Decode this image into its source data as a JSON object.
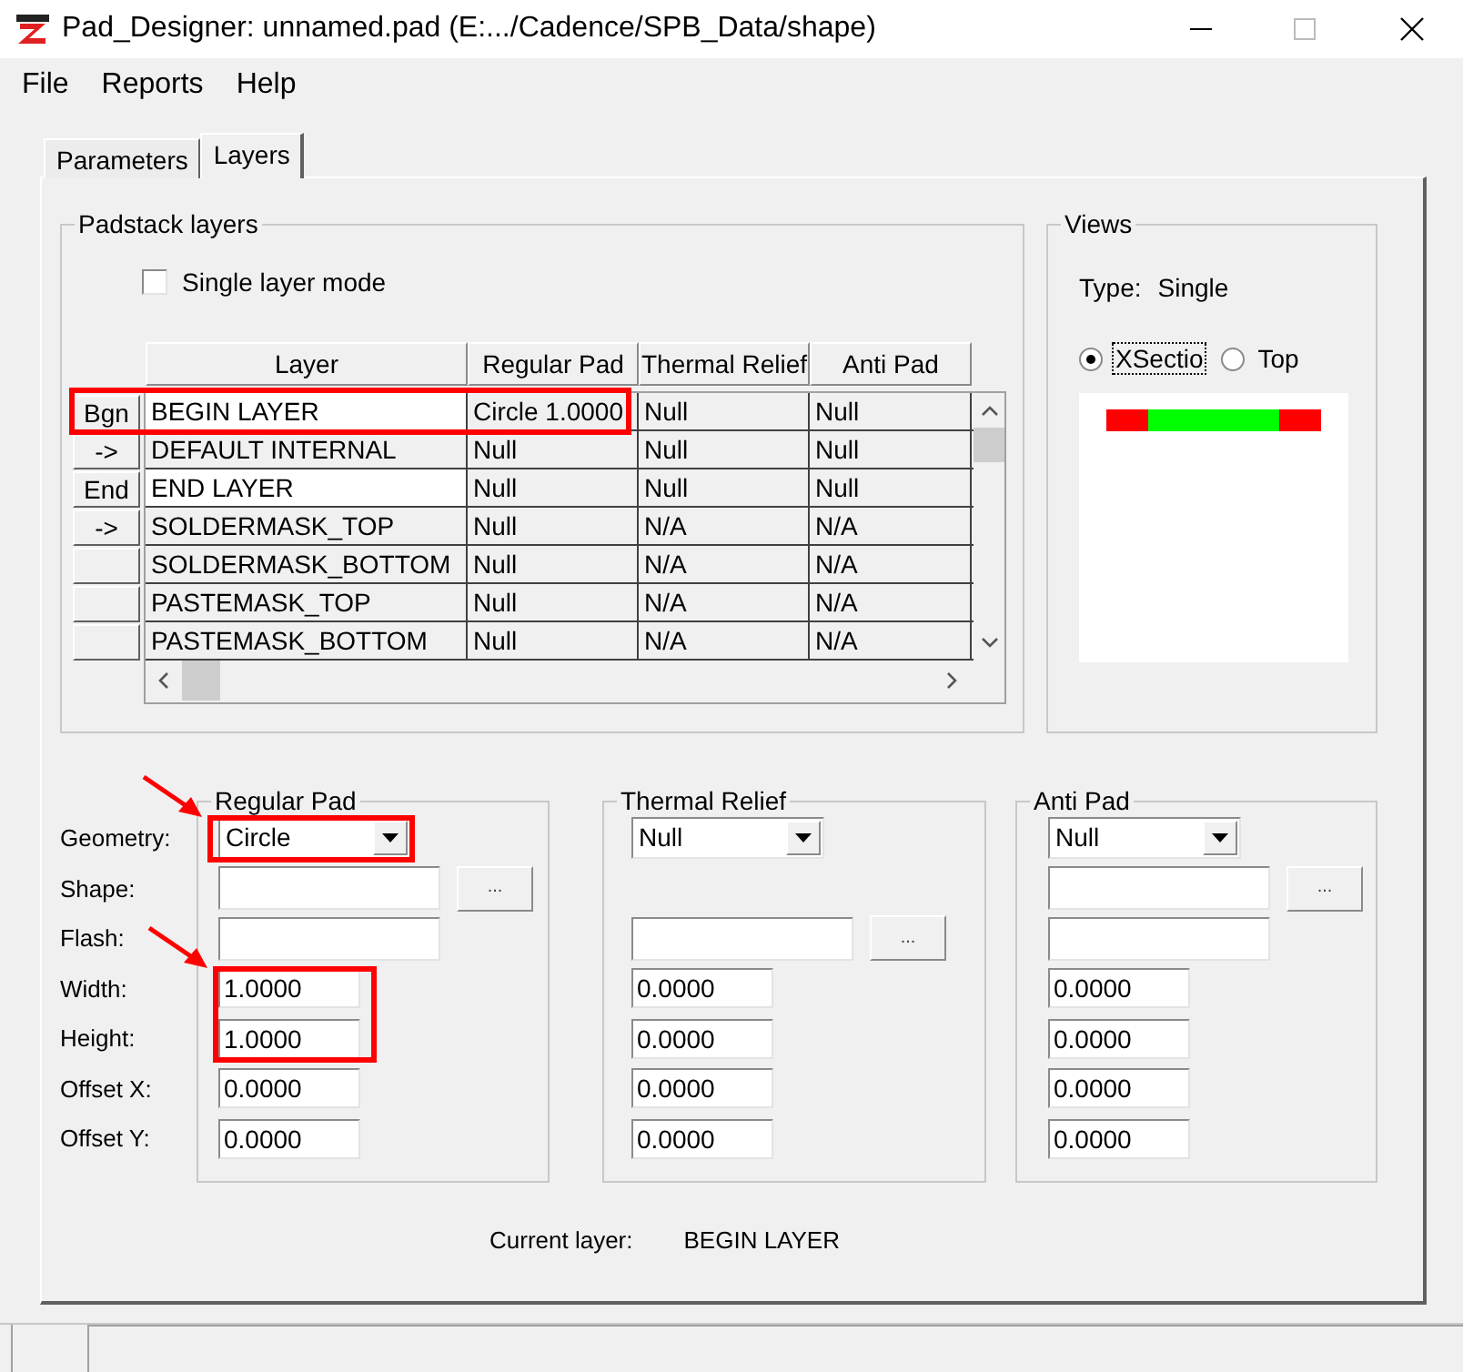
{
  "window": {
    "title": "Pad_Designer: unnamed.pad (E:.../Cadence/SPB_Data/shape)"
  },
  "menu": [
    "File",
    "Reports",
    "Help"
  ],
  "tabs": [
    {
      "label": "Parameters",
      "selected": false
    },
    {
      "label": "Layers",
      "selected": true
    }
  ],
  "padstack_layers": {
    "title": "Padstack layers",
    "single_layer_mode": {
      "label": "Single layer mode",
      "checked": false
    },
    "columns": [
      "Layer",
      "Regular Pad",
      "Thermal Relief",
      "Anti Pad"
    ],
    "rows": [
      {
        "button": "Bgn",
        "layer": "BEGIN LAYER",
        "regular_pad": "Circle 1.0000",
        "thermal_relief": "Null",
        "anti_pad": "Null",
        "emphasized": true,
        "marked": true
      },
      {
        "button": "->",
        "layer": "DEFAULT INTERNAL",
        "regular_pad": "Null",
        "thermal_relief": "Null",
        "anti_pad": "Null",
        "emphasized": false,
        "marked": false
      },
      {
        "button": "End",
        "layer": "END LAYER",
        "regular_pad": "Null",
        "thermal_relief": "Null",
        "anti_pad": "Null",
        "emphasized": true,
        "marked": false
      },
      {
        "button": "->",
        "layer": "SOLDERMASK_TOP",
        "regular_pad": "Null",
        "thermal_relief": "N/A",
        "anti_pad": "N/A",
        "emphasized": false,
        "marked": false
      },
      {
        "layer": "SOLDERMASK_BOTTOM",
        "regular_pad": "Null",
        "thermal_relief": "N/A",
        "anti_pad": "N/A",
        "emphasized": false,
        "marked": false
      },
      {
        "layer": "PASTEMASK_TOP",
        "regular_pad": "Null",
        "thermal_relief": "N/A",
        "anti_pad": "N/A",
        "emphasized": false,
        "marked": false
      },
      {
        "layer": "PASTEMASK_BOTTOM",
        "regular_pad": "Null",
        "thermal_relief": "N/A",
        "anti_pad": "N/A",
        "emphasized": false,
        "marked": false
      }
    ]
  },
  "views": {
    "title": "Views",
    "type_label": "Type:",
    "type_value": "Single",
    "options": [
      {
        "label": "XSectio",
        "selected": true,
        "focused": true
      },
      {
        "label": "Top",
        "selected": false,
        "focused": false
      }
    ],
    "preview_segments": [
      {
        "color": "#ff0000"
      },
      {
        "color": "#00ff00"
      },
      {
        "color": "#ff0000"
      }
    ]
  },
  "field_labels": [
    "Geometry:",
    "Shape:",
    "Flash:",
    "Width:",
    "Height:",
    "Offset X:",
    "Offset Y:"
  ],
  "pads": [
    {
      "title": "Regular Pad",
      "rows": [
        {
          "kind": "dropdown",
          "value": "Circle",
          "marked": true
        },
        {
          "kind": "browse",
          "button": "...",
          "marked": false
        },
        {
          "kind": "text",
          "marked": false
        },
        {
          "kind": "number",
          "value": "1.0000",
          "marked": true
        },
        {
          "kind": "number",
          "value": "1.0000",
          "marked": true
        },
        {
          "kind": "number",
          "value": "0.0000",
          "marked": false
        },
        {
          "kind": "number",
          "value": "0.0000",
          "marked": false
        }
      ]
    },
    {
      "title": "Thermal Relief",
      "rows": [
        {
          "kind": "dropdown",
          "value": "Null",
          "marked": false
        },
        {
          "kind": "empty",
          "marked": false
        },
        {
          "kind": "browse",
          "button": "...",
          "marked": false
        },
        {
          "kind": "number",
          "value": "0.0000",
          "marked": false
        },
        {
          "kind": "number",
          "value": "0.0000",
          "marked": false
        },
        {
          "kind": "number",
          "value": "0.0000",
          "marked": false
        },
        {
          "kind": "number",
          "value": "0.0000",
          "marked": false
        }
      ]
    },
    {
      "title": "Anti Pad",
      "rows": [
        {
          "kind": "dropdown",
          "value": "Null",
          "marked": false
        },
        {
          "kind": "browse",
          "button": "...",
          "marked": false
        },
        {
          "kind": "text",
          "marked": false
        },
        {
          "kind": "number",
          "value": "0.0000",
          "marked": false
        },
        {
          "kind": "number",
          "value": "0.0000",
          "marked": false
        },
        {
          "kind": "number",
          "value": "0.0000",
          "marked": false
        },
        {
          "kind": "number",
          "value": "0.0000",
          "marked": false
        }
      ]
    }
  ],
  "current_layer": {
    "label": "Current layer:",
    "value": "BEGIN LAYER"
  }
}
